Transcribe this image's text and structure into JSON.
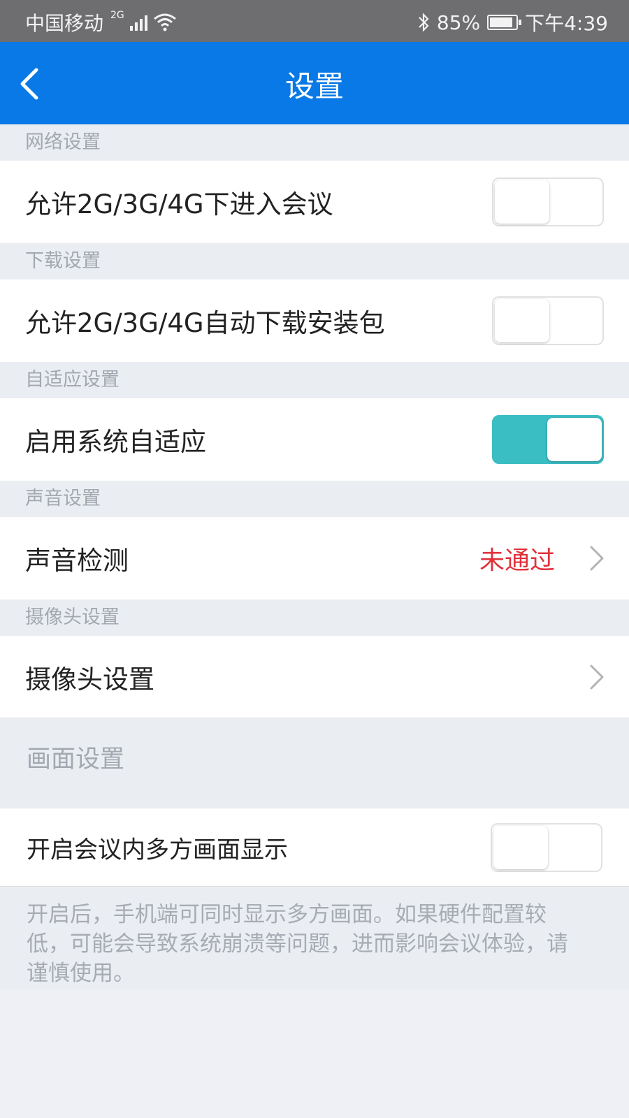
{
  "status_bar": {
    "carrier": "中国移动",
    "network_type": "2G",
    "battery_percent": "85%",
    "time": "下午4:39",
    "icons": [
      "signal-icon",
      "wifi-icon",
      "bluetooth-icon",
      "battery-icon"
    ]
  },
  "header": {
    "title": "设置",
    "background_color": "#0879e6"
  },
  "sections": {
    "network": {
      "title": "网络设置",
      "item_label": "允许2G/3G/4G下进入会议",
      "toggle_on": false
    },
    "download": {
      "title": "下载设置",
      "item_label": "允许2G/3G/4G自动下载安装包",
      "toggle_on": false
    },
    "adaptive": {
      "title": "自适应设置",
      "item_label": "启用系统自适应",
      "toggle_on": true,
      "toggle_color": "#3bbdc4"
    },
    "sound": {
      "title": "声音设置",
      "item_label": "声音检测",
      "status": "未通过",
      "status_color": "#e0313a"
    },
    "camera": {
      "title": "摄像头设置",
      "item_label": "摄像头设置"
    },
    "display": {
      "title": "画面设置",
      "item_label": "开启会议内多方画面显示",
      "toggle_on": false,
      "note": "开启后，手机端可同时显示多方画面。如果硬件配置较低，可能会导致系统崩溃等问题，进而影响会议体验，请谨慎使用。"
    }
  }
}
